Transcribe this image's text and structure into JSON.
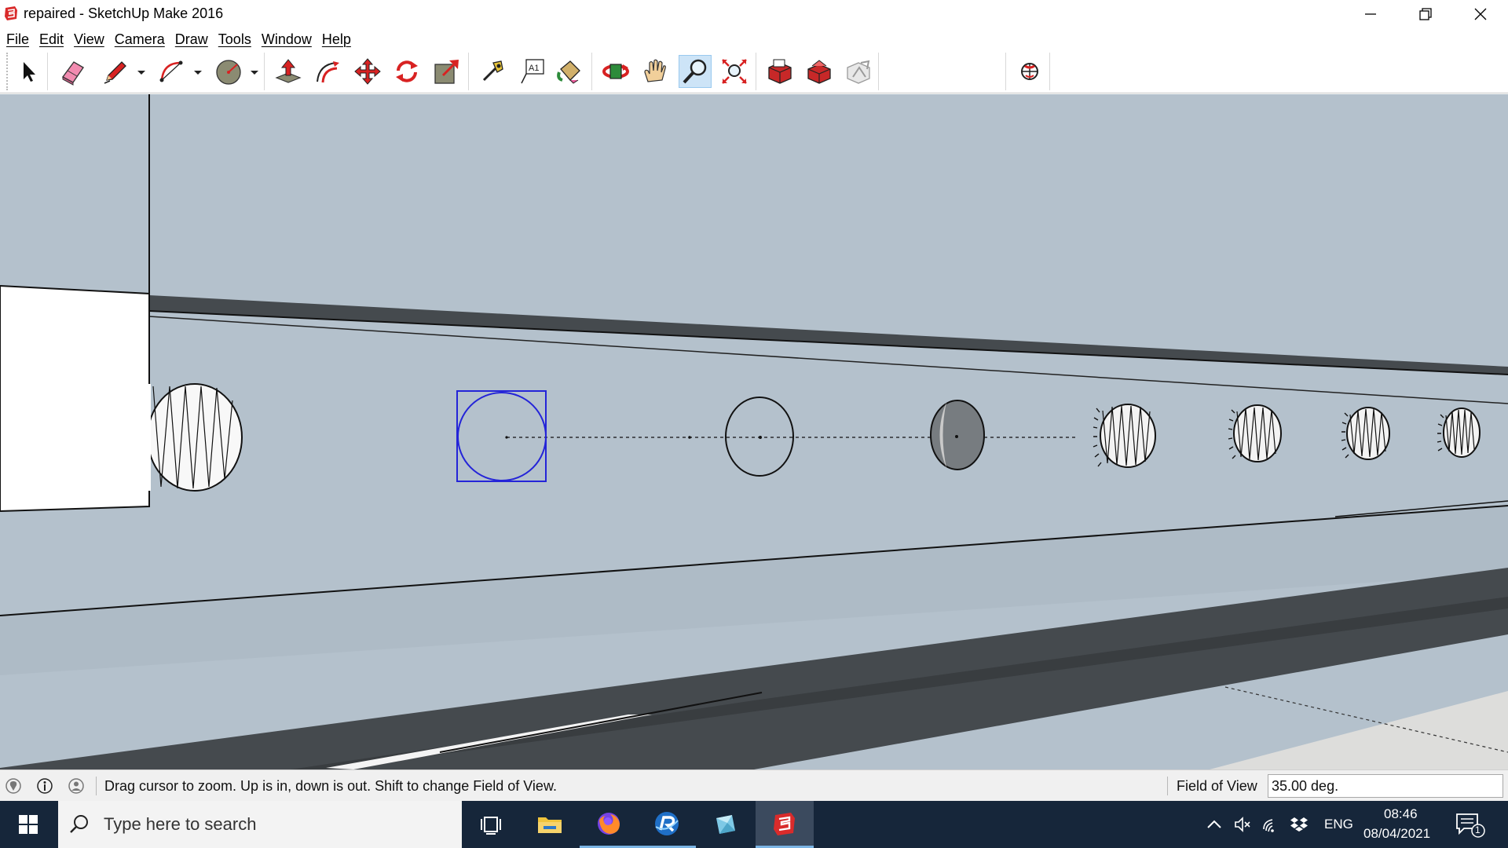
{
  "window": {
    "title": "repaired - SketchUp Make 2016",
    "controls": [
      "minimize",
      "restore",
      "close"
    ]
  },
  "menu": [
    "File",
    "Edit",
    "View",
    "Camera",
    "Draw",
    "Tools",
    "Window",
    "Help"
  ],
  "toolbar": {
    "tools": [
      {
        "name": "select-tool",
        "icon": "arrow-cursor-icon"
      },
      {
        "name": "eraser-tool",
        "icon": "eraser-icon"
      },
      {
        "name": "line-tool",
        "icon": "pencil-icon"
      },
      {
        "name": "arc-tool",
        "icon": "arc-icon"
      },
      {
        "name": "shape-tool",
        "icon": "circle-shape-icon"
      },
      {
        "name": "push-pull-tool",
        "icon": "push-pull-icon"
      },
      {
        "name": "offset-tool",
        "icon": "offset-icon"
      },
      {
        "name": "move-tool",
        "icon": "move-icon"
      },
      {
        "name": "rotate-tool",
        "icon": "rotate-icon"
      },
      {
        "name": "scale-tool",
        "icon": "scale-icon"
      },
      {
        "name": "tape-measure-tool",
        "icon": "tape-measure-icon"
      },
      {
        "name": "text-tool",
        "icon": "text-icon"
      },
      {
        "name": "paint-bucket-tool",
        "icon": "paint-bucket-icon"
      },
      {
        "name": "orbit-tool",
        "icon": "orbit-icon"
      },
      {
        "name": "pan-tool",
        "icon": "hand-icon"
      },
      {
        "name": "zoom-tool",
        "icon": "zoom-icon"
      },
      {
        "name": "zoom-extents-tool",
        "icon": "zoom-extents-icon"
      },
      {
        "name": "warehouse-tool",
        "icon": "3d-warehouse-icon"
      },
      {
        "name": "extension-warehouse-tool",
        "icon": "extension-warehouse-icon"
      },
      {
        "name": "share-model-tool",
        "icon": "share-model-icon"
      },
      {
        "name": "geolocation-tool",
        "icon": "globe-icon"
      }
    ],
    "text_tool_glyph": "A1",
    "active_tool": "zoom-tool"
  },
  "status": {
    "message": "Drag cursor to zoom.  Up is in, down is out. Shift to change Field of View.",
    "measurement_label": "Field of View",
    "measurement_value": "35.00 deg."
  },
  "taskbar": {
    "search_placeholder": "Type here to search",
    "apps": [
      "task-view",
      "file-explorer",
      "firefox",
      "rsync-app",
      "crystal-app",
      "sketchup"
    ],
    "tray": {
      "language": "ENG",
      "time": "08:46",
      "date": "08/04/2021",
      "notification_count": "1"
    }
  },
  "colors": {
    "sky_wall": "#b4c1cc",
    "dark_band": "#454a4e",
    "ground": "#dddddb",
    "selection_blue": "#2424d8",
    "taskbar": "#16263a",
    "active_tool_bg": "#cde4f7"
  }
}
